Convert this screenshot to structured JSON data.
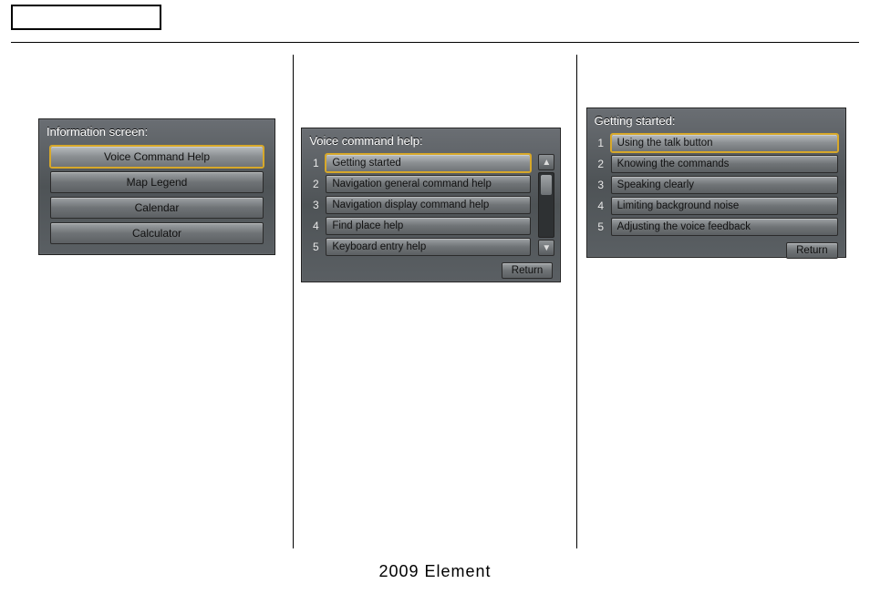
{
  "footer": "2009  Element",
  "panel1": {
    "title": "Information screen:",
    "items": [
      {
        "label": "Voice Command Help",
        "selected": true
      },
      {
        "label": "Map Legend",
        "selected": false
      },
      {
        "label": "Calendar",
        "selected": false
      },
      {
        "label": "Calculator",
        "selected": false
      }
    ]
  },
  "panel2": {
    "title": "Voice command help:",
    "items": [
      {
        "num": "1",
        "label": "Getting started",
        "selected": true
      },
      {
        "num": "2",
        "label": "Navigation general command help",
        "selected": false
      },
      {
        "num": "3",
        "label": "Navigation display command help",
        "selected": false
      },
      {
        "num": "4",
        "label": "Find place help",
        "selected": false
      },
      {
        "num": "5",
        "label": "Keyboard entry help",
        "selected": false
      }
    ],
    "return": "Return",
    "scroll_up": "▲",
    "scroll_down": "▼"
  },
  "panel3": {
    "title": "Getting started:",
    "items": [
      {
        "num": "1",
        "label": "Using the talk button",
        "selected": true
      },
      {
        "num": "2",
        "label": "Knowing the commands",
        "selected": false
      },
      {
        "num": "3",
        "label": "Speaking clearly",
        "selected": false
      },
      {
        "num": "4",
        "label": "Limiting background noise",
        "selected": false
      },
      {
        "num": "5",
        "label": "Adjusting the voice feedback",
        "selected": false
      }
    ],
    "return": "Return"
  }
}
